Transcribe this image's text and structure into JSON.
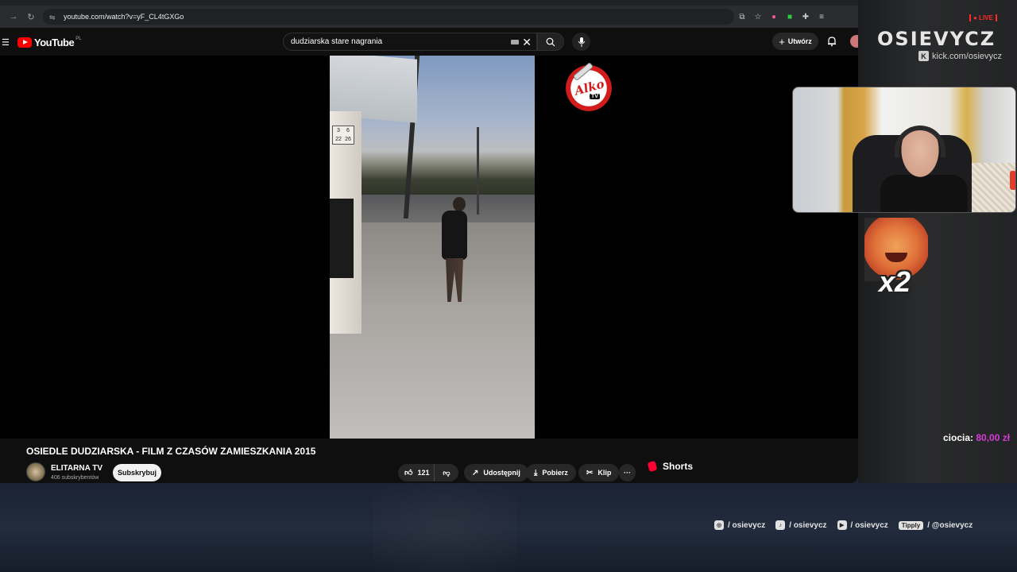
{
  "browser": {
    "url": "youtube.com/watch?v=yF_CL4tGXGo"
  },
  "yt": {
    "logo_text": "YouTube",
    "logo_country": "PL",
    "search_value": "dudziarska stare nagrania",
    "create_label": "Utwórz"
  },
  "video": {
    "title": "OSIEDLE DUDZIARSKA - FILM Z CZASÓW ZAMIESZKANIA 2015",
    "stop_sign_numbers": [
      "3",
      "6",
      "22",
      "26"
    ],
    "channel_logo_text": "Alko",
    "channel_logo_sub": "TV"
  },
  "channel": {
    "name": "ELITARNA TV",
    "subscribers": "406 subskrybentów",
    "subscribe_label": "Subskrybuj"
  },
  "actions": {
    "likes": "121",
    "share_label": "Udostępnij",
    "download_label": "Pobierz",
    "clip_label": "Klip",
    "more_label": "···",
    "shorts_label": "Shorts"
  },
  "overlay": {
    "live_label": "● LIVE",
    "brand": "OSIEVYCZ",
    "kick_handle": "kick.com/osievycz",
    "meme_caption": "x2",
    "donation_name": "ciocia:",
    "donation_amount": "80,00 zł",
    "socials": [
      {
        "icon": "instagram-icon",
        "label": "/ osievycz"
      },
      {
        "icon": "tiktok-icon",
        "label": "/ osievycz"
      },
      {
        "icon": "youtube-icon",
        "label": "/ osievycz"
      },
      {
        "icon": "tipply-icon",
        "badge": "Tipply",
        "label": "/ @osievycz"
      }
    ]
  },
  "colors": {
    "yt_red": "#ff0000",
    "donation_amount": "#d63bd6",
    "live_red": "#ff2a2a"
  }
}
